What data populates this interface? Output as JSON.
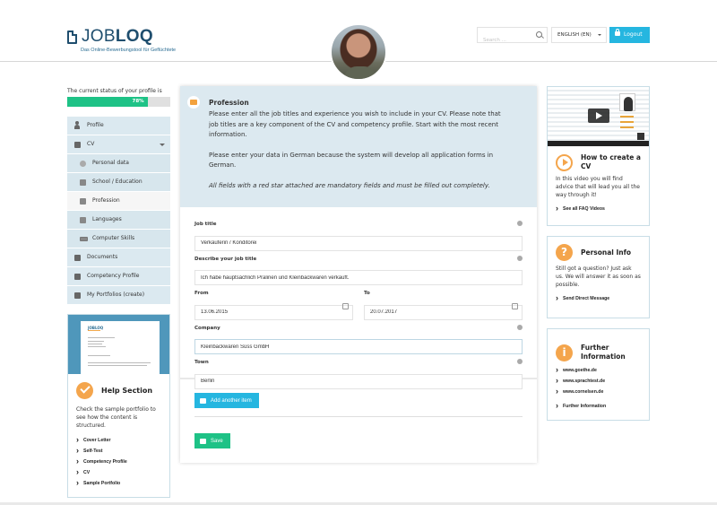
{
  "header": {
    "logo_light": "JOB",
    "logo_bold": "LOQ",
    "tagline": "Das Online-Bewerbungstool für Geflüchtete",
    "search_placeholder": "Search ...",
    "language": "ENGLISH (EN)",
    "logout_label": "Logout"
  },
  "profile_status": {
    "label": "The current status of your profile is",
    "percent": 78,
    "percent_label": "78%"
  },
  "sidebar": {
    "items": [
      {
        "label": "Profile",
        "icon": "person-icon"
      },
      {
        "label": "CV",
        "icon": "document-icon"
      },
      {
        "label": "Personal data",
        "icon": "personal-data-icon"
      },
      {
        "label": "School / Education",
        "icon": "graduation-cap-icon"
      },
      {
        "label": "Profession",
        "icon": "briefcase-icon"
      },
      {
        "label": "Languages",
        "icon": "translate-icon"
      },
      {
        "label": "Computer Skills",
        "icon": "laptop-icon"
      },
      {
        "label": "Documents",
        "icon": "file-icon"
      },
      {
        "label": "Competency Profile",
        "icon": "folder-icon"
      },
      {
        "label": "My Portfolios (create)",
        "icon": "book-icon"
      }
    ]
  },
  "help_section": {
    "doc_logo": "JOBLOQ",
    "title": "Help Section",
    "text": "Check the sample portfolio to see how the content is structured.",
    "links": [
      "Cover Letter",
      "Self-Test",
      "Competency Profile",
      "CV",
      "Sample Portfolio"
    ]
  },
  "intro": {
    "title": "Profession",
    "paragraph1": "Please enter all the job titles and experience you wish to include in your CV. Please note that job titles are a key component of the CV and competency profile. Start with the most recent information.",
    "paragraph2": "Please enter your data in German because the system will develop all application forms in German.",
    "note": "All fields with a red star attached are mandatory fields and must be filled out completely."
  },
  "form": {
    "job_title": {
      "label": "Job title",
      "value": "Verkäuferin / Konditorei"
    },
    "description": {
      "label": "Describe your job title",
      "value": "Ich habe hauptsächlich Pralinen und Kleinbackwaren verkauft."
    },
    "from": {
      "label": "From",
      "value": "13.06.2015"
    },
    "to": {
      "label": "To",
      "value": "20.07.2017"
    },
    "company": {
      "label": "Company",
      "value": "Kleinbackwaren Süss GmbH"
    },
    "town": {
      "label": "Town",
      "value": "Berlin"
    },
    "add_label": "Add another item",
    "save_label": "Save"
  },
  "right": {
    "video_card": {
      "title": "How to create a CV",
      "text": "In this video you will find advice that will lead you all the way through it!",
      "link": "See all FAQ Videos"
    },
    "personal_info": {
      "title": "Personal Info",
      "text": "Still got a question? Just ask us. We will answer it as soon as possible.",
      "link": "Send Direct Message"
    },
    "further_info": {
      "title": "Further Information",
      "links": [
        "www.goethe.de",
        "www.sprachtest.de",
        "www.cornelsen.de",
        "Further Information"
      ]
    }
  },
  "colors": {
    "accent_blue": "#25b6e0",
    "accent_green": "#1ec286",
    "accent_orange": "#f4a54c",
    "brand_navy": "#1f4e6e",
    "panel_blue": "#dce9f0"
  }
}
